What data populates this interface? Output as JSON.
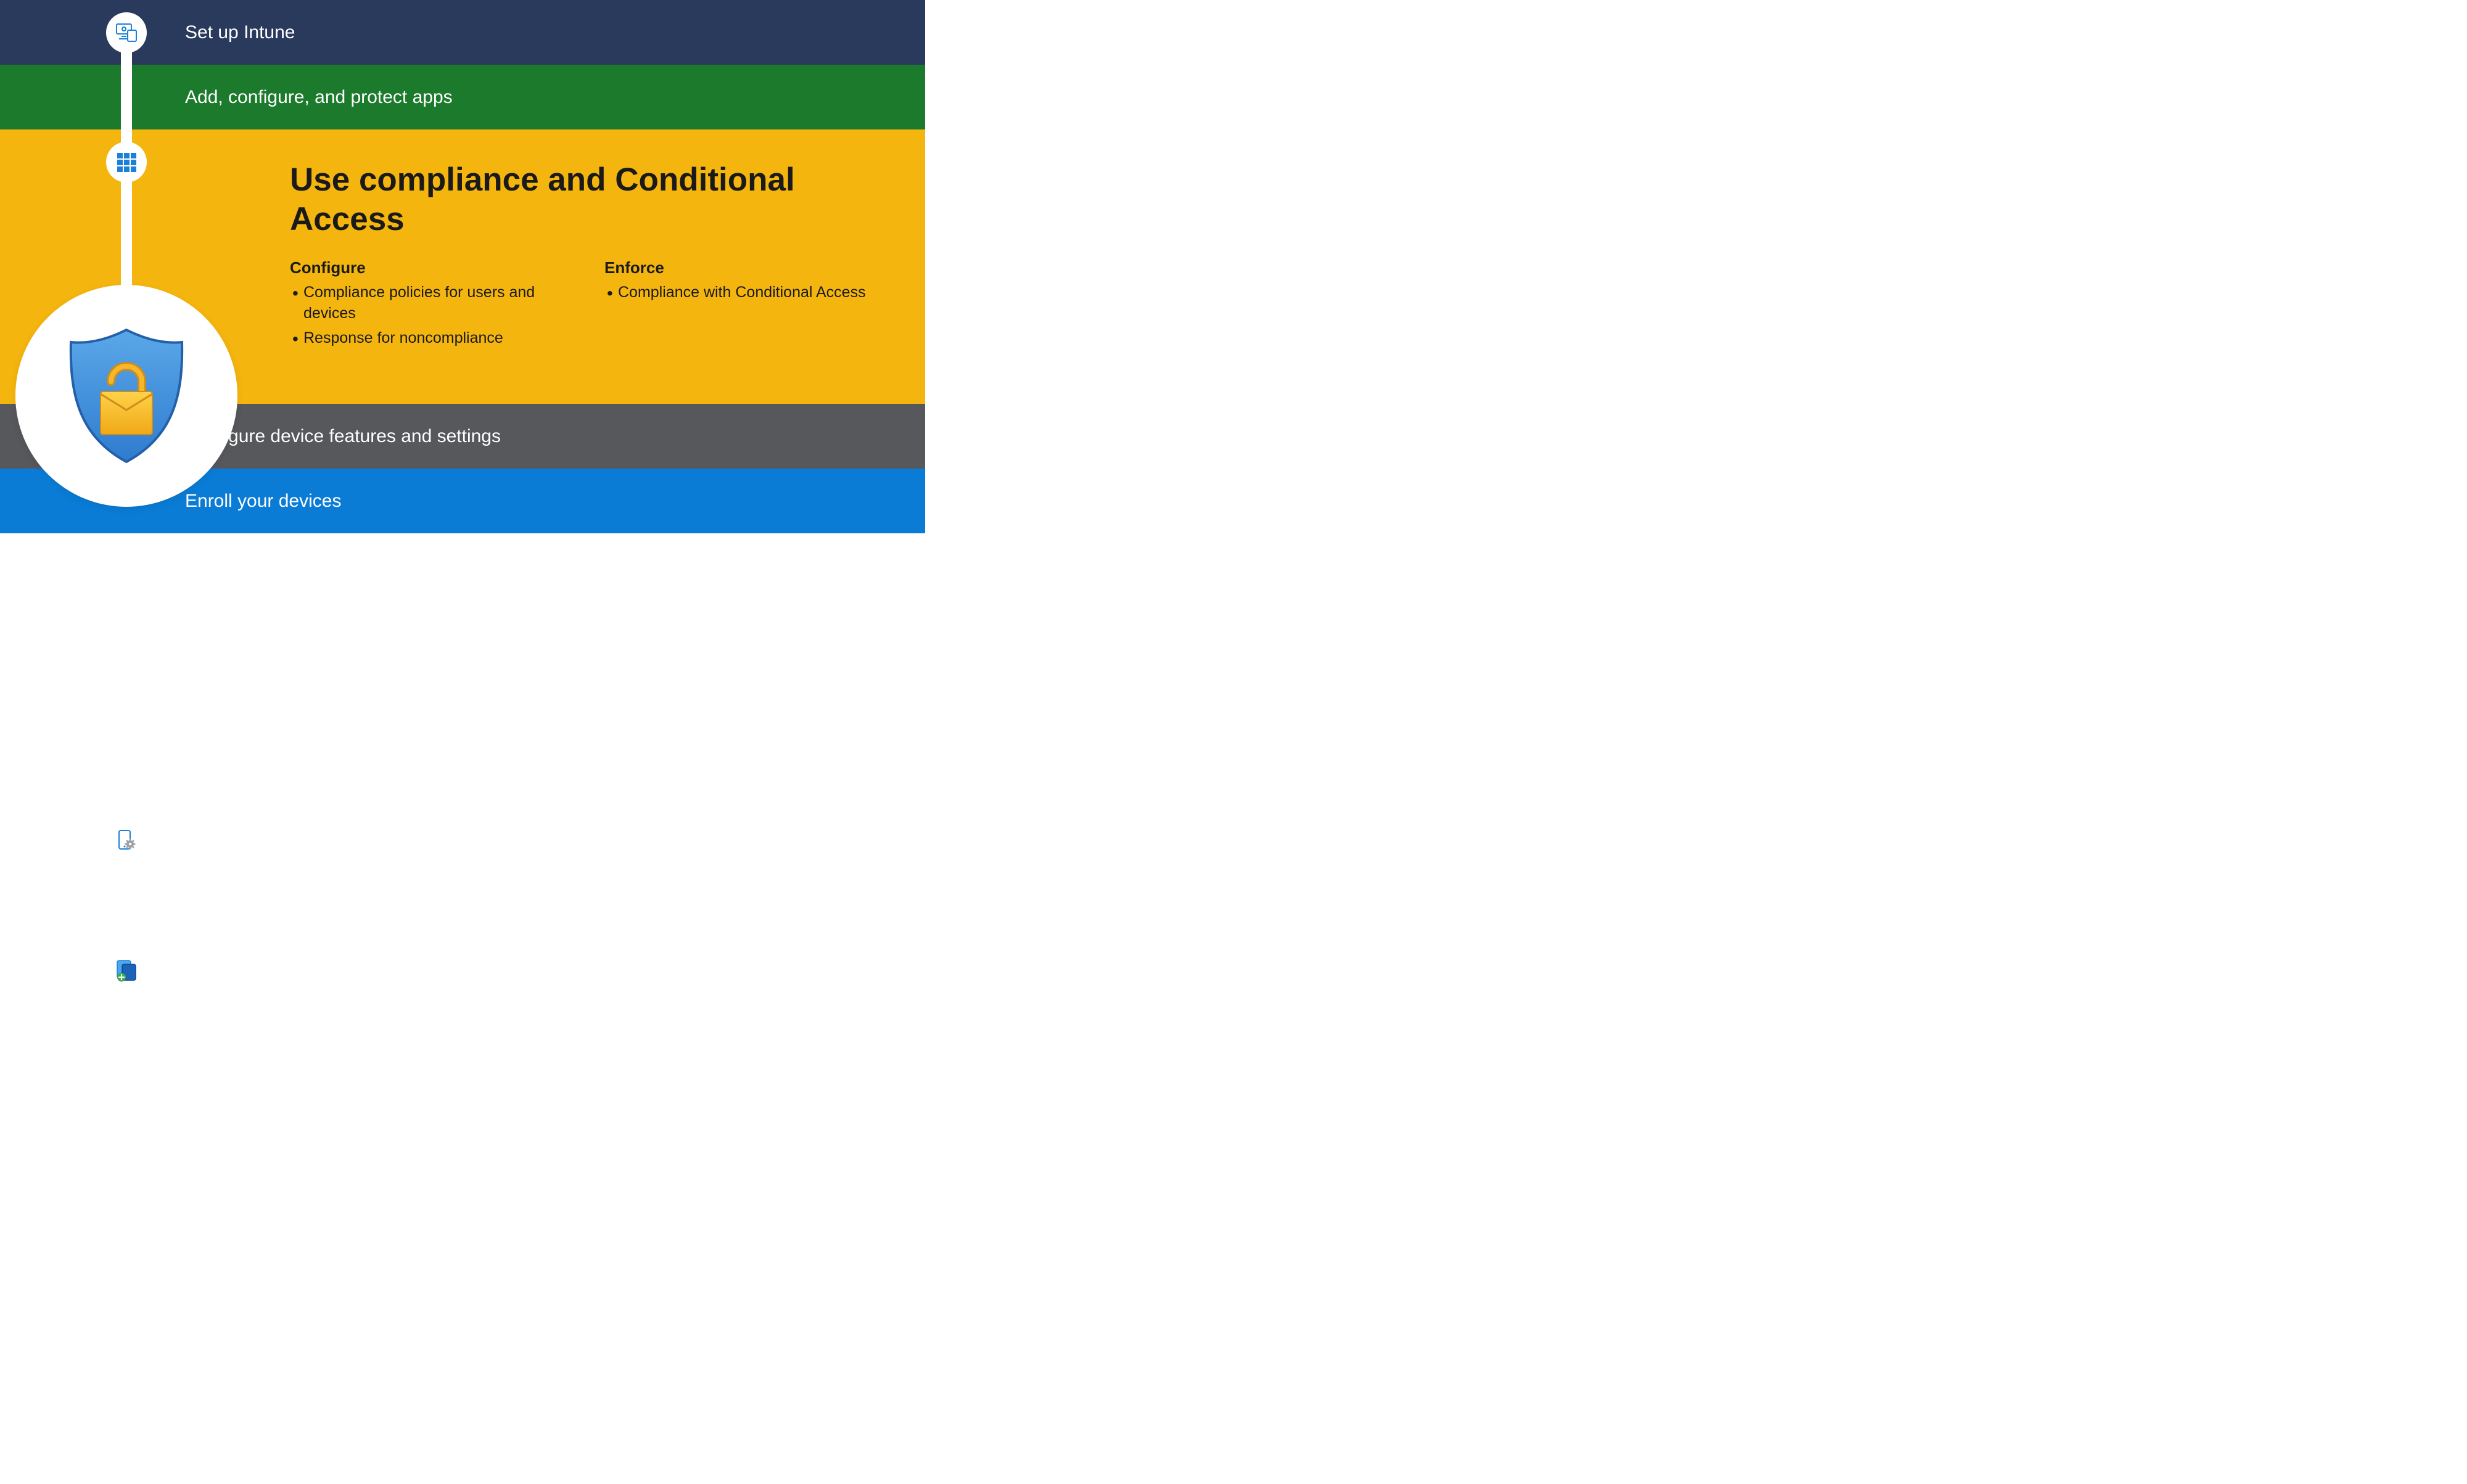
{
  "steps": [
    {
      "label": "Set up Intune",
      "color": "#2a3a5c",
      "icon": "monitor"
    },
    {
      "label": "Add, configure, and protect apps",
      "color": "#1c7a2c",
      "icon": "apps"
    },
    {
      "label": "Use compliance and Conditional Access",
      "color": "#f5b50f",
      "icon": "shield-lock",
      "active": true,
      "columns": [
        {
          "title": "Configure",
          "items": [
            "Compliance policies for users and devices",
            "Response for noncompliance"
          ]
        },
        {
          "title": "Enforce",
          "items": [
            "Compliance with Conditional Access"
          ]
        }
      ]
    },
    {
      "label": "Configure device features and settings",
      "color": "#56585c",
      "icon": "device-gear"
    },
    {
      "label": "Enroll your devices",
      "color": "#0a7cd6",
      "icon": "enroll"
    }
  ]
}
